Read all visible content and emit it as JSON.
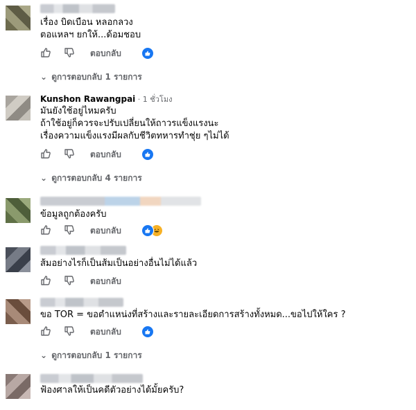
{
  "actions": {
    "reply_label": "ตอบกลับ"
  },
  "comments": [
    {
      "author": "",
      "meta": "",
      "lines": [
        "เรื่อง บิดเบือน หลอกลวง",
        "ตอแหลฯ ยกให้...ด้อมชอบ"
      ],
      "reactions": [
        "like"
      ],
      "view_replies": "ดูการตอบกลับ 1 รายการ"
    },
    {
      "author": "Kunshon Rawangpai",
      "meta": " · 1 ชั่วโมง",
      "lines": [
        "มันยังใช้อยู่ไหมครับ",
        "ถ้าใช้อยู่ก็ควรจะปรับเปลี่ยนให้ถาวรแข็งแรงนะ",
        "เรื่องความแข็งแรงมีผลกับชีวิตทหารทำชุ่ย ๆไม่ได้"
      ],
      "reactions": [
        "like"
      ],
      "view_replies": "ดูการตอบกลับ 4 รายการ"
    },
    {
      "author": "",
      "meta": "",
      "lines": [
        "ข้อมูลถูกต้องครับ"
      ],
      "reactions": [
        "like",
        "haha"
      ],
      "view_replies": ""
    },
    {
      "author": "",
      "meta": "",
      "lines": [
        "ส้มอย่างไรก็เป็นส้มเป็นอย่างอื่นไม่ได้แล้ว"
      ],
      "reactions": [],
      "view_replies": ""
    },
    {
      "author": "",
      "meta": "",
      "lines": [
        "ขอ TOR = ขอตำแหน่งที่สร้างและรายละเอียดการสร้างทั้งหมด...ขอไปให้ใคร ?"
      ],
      "reactions": [
        "like"
      ],
      "view_replies": "ดูการตอบกลับ 1 รายการ"
    },
    {
      "author": "",
      "meta": "",
      "lines": [
        "ฟ้องศาลให้เป็นคดีตัวอย่างได้มั้ยครับ?"
      ],
      "reactions": [],
      "view_replies": ""
    }
  ],
  "colors": {
    "like_blue": "#1877f2",
    "muted": "#65676b"
  },
  "icons": {
    "like": "thumbs-up-icon",
    "dislike": "thumbs-down-icon",
    "reply_chevron": "chevron-down-icon"
  }
}
